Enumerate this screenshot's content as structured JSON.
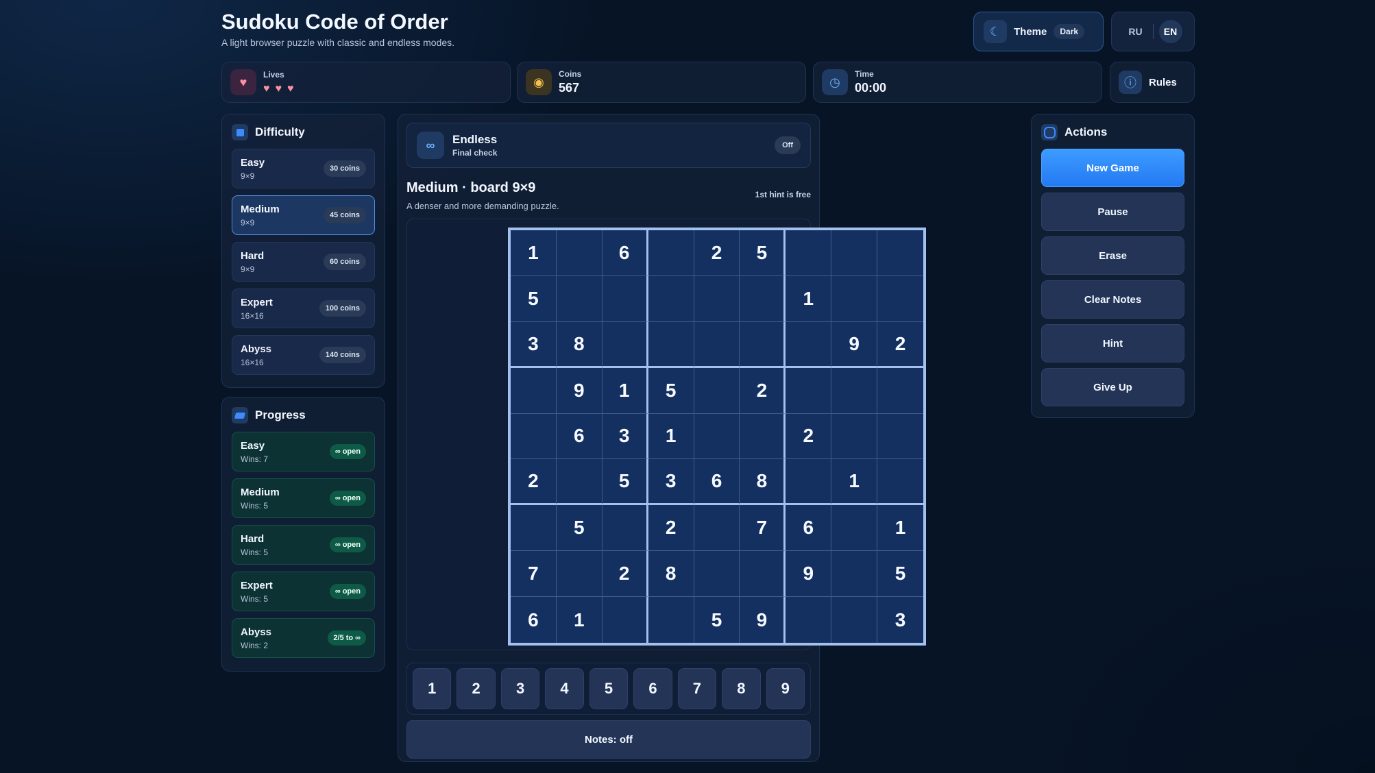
{
  "header": {
    "title": "Sudoku Code of Order",
    "subtitle": "A light browser puzzle with classic and endless modes.",
    "theme_label": "Theme",
    "theme_value": "Dark",
    "theme_icon": "moon-icon",
    "lang_ru": "RU",
    "lang_en": "EN",
    "lang_active": "EN"
  },
  "stats": {
    "lives_label": "Lives",
    "lives_count": 3,
    "coins_label": "Coins",
    "coins_value": "567",
    "time_label": "Time",
    "time_value": "00:00",
    "rules_label": "Rules"
  },
  "difficulty": {
    "title": "Difficulty",
    "items": [
      {
        "name": "Easy",
        "size": "9×9",
        "reward": "30 coins"
      },
      {
        "name": "Medium",
        "size": "9×9",
        "reward": "45 coins"
      },
      {
        "name": "Hard",
        "size": "9×9",
        "reward": "60 coins"
      },
      {
        "name": "Expert",
        "size": "16×16",
        "reward": "100 coins"
      },
      {
        "name": "Abyss",
        "size": "16×16",
        "reward": "140 coins"
      }
    ],
    "selected": "Medium"
  },
  "progress": {
    "title": "Progress",
    "items": [
      {
        "name": "Easy",
        "wins": "Wins: 7",
        "status": "∞ open"
      },
      {
        "name": "Medium",
        "wins": "Wins: 5",
        "status": "∞ open"
      },
      {
        "name": "Hard",
        "wins": "Wins: 5",
        "status": "∞ open"
      },
      {
        "name": "Expert",
        "wins": "Wins: 5",
        "status": "∞ open"
      },
      {
        "name": "Abyss",
        "wins": "Wins: 2",
        "status": "2/5 to ∞"
      }
    ]
  },
  "mode": {
    "icon": "∞",
    "title": "Endless",
    "subtitle": "Final check",
    "toggle": "Off"
  },
  "board": {
    "title": "Medium · board 9×9",
    "description": "A denser and more demanding puzzle.",
    "hint_note": "1st hint is free",
    "cells": [
      [
        "1",
        "",
        "6",
        "",
        "2",
        "5",
        "",
        "",
        ""
      ],
      [
        "5",
        "",
        "",
        "",
        "",
        "",
        "1",
        "",
        ""
      ],
      [
        "3",
        "8",
        "",
        "",
        "",
        "",
        "",
        "9",
        "2"
      ],
      [
        "",
        "9",
        "1",
        "5",
        "",
        "2",
        "",
        "",
        ""
      ],
      [
        "",
        "6",
        "3",
        "1",
        "",
        "",
        "2",
        "",
        ""
      ],
      [
        "2",
        "",
        "5",
        "3",
        "6",
        "8",
        "",
        "1",
        ""
      ],
      [
        "",
        "5",
        "",
        "2",
        "",
        "7",
        "6",
        "",
        "1"
      ],
      [
        "7",
        "",
        "2",
        "8",
        "",
        "",
        "9",
        "",
        "5"
      ],
      [
        "6",
        "1",
        "",
        "",
        "5",
        "9",
        "",
        "",
        "3"
      ]
    ]
  },
  "numpad": [
    "1",
    "2",
    "3",
    "4",
    "5",
    "6",
    "7",
    "8",
    "9"
  ],
  "notes_label": "Notes: off",
  "actions": {
    "title": "Actions",
    "new_game": "New Game",
    "pause": "Pause",
    "erase": "Erase",
    "clear_notes": "Clear Notes",
    "hint": "Hint",
    "give_up": "Give Up"
  }
}
